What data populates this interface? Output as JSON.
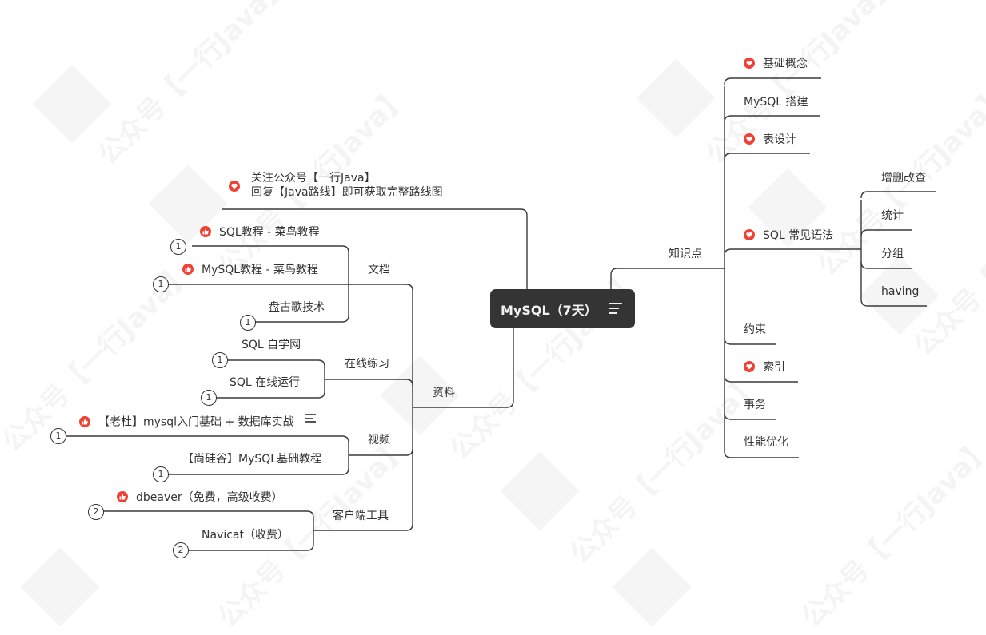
{
  "watermark": "公众号【一行Java】",
  "colors": {
    "root_bg": "#343434",
    "icon_red": "#f04134",
    "line": "#3a3a3a"
  },
  "root": {
    "label": "MySQL（7天）",
    "icon": "note-lines-icon"
  },
  "left": {
    "promo": {
      "line1": "关注公众号【一行Java】",
      "line2": "回复【Java路线】即可获取完整路线图",
      "icon": "heart-icon"
    },
    "branch": "资料",
    "groups": [
      {
        "label": "文档",
        "items": [
          {
            "label": "SQL教程 - 菜鸟教程",
            "icon": "thumbs-up-icon",
            "badge": "1"
          },
          {
            "label": "MySQL教程 - 菜鸟教程",
            "icon": "thumbs-up-icon",
            "badge": "1"
          },
          {
            "label": "盘古歌技术",
            "icon": null,
            "badge": "1"
          }
        ]
      },
      {
        "label": "在线练习",
        "items": [
          {
            "label": "SQL 自学网",
            "icon": null,
            "badge": "1"
          },
          {
            "label": "SQL 在线运行",
            "icon": null,
            "badge": "1"
          }
        ]
      },
      {
        "label": "视频",
        "items": [
          {
            "label": "【老杜】mysql入门基础 + 数据库实战",
            "icon": "thumbs-up-icon",
            "badge": "1",
            "note": "note-lines-icon"
          },
          {
            "label": "【尚硅谷】MySQL基础教程",
            "icon": null,
            "badge": "1"
          }
        ]
      },
      {
        "label": "客户端工具",
        "items": [
          {
            "label": "dbeaver（免费，高级收费）",
            "icon": "thumbs-up-icon",
            "badge": "2"
          },
          {
            "label": "Navicat（收费）",
            "icon": null,
            "badge": "2"
          }
        ]
      }
    ]
  },
  "right": {
    "branch": "知识点",
    "items": [
      {
        "label": "基础概念",
        "icon": "heart-icon"
      },
      {
        "label": "MySQL 搭建",
        "icon": null
      },
      {
        "label": "表设计",
        "icon": "heart-icon"
      },
      {
        "label": "SQL 常见语法",
        "icon": "heart-icon",
        "children": [
          "增删改查",
          "统计",
          "分组",
          "having"
        ]
      },
      {
        "label": "约束",
        "icon": null
      },
      {
        "label": "索引",
        "icon": "heart-icon"
      },
      {
        "label": "事务",
        "icon": null
      },
      {
        "label": "性能优化",
        "icon": null
      }
    ]
  }
}
